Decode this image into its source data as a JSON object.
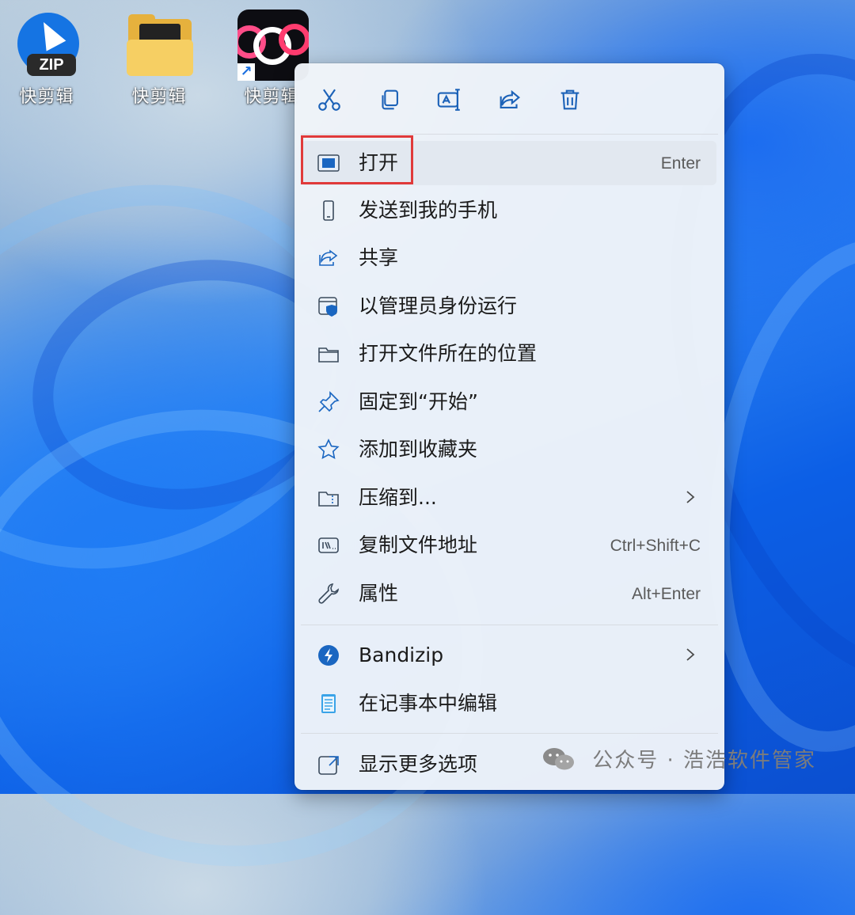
{
  "desktop": {
    "icons": [
      {
        "label": "快剪辑",
        "icon": "zip-archive-icon",
        "badge": "ZIP"
      },
      {
        "label": "快剪辑",
        "icon": "folder-icon"
      },
      {
        "label": "快剪辑",
        "icon": "app-shortcut-icon"
      }
    ]
  },
  "toolbar": {
    "buttons": [
      "cut-icon",
      "copy-icon",
      "rename-icon",
      "share-icon",
      "delete-icon"
    ]
  },
  "menu": {
    "items": [
      {
        "label": "打开",
        "shortcut": "Enter",
        "icon": "open-app-icon"
      },
      {
        "label": "发送到我的手机",
        "icon": "phone-icon"
      },
      {
        "label": "共享",
        "icon": "share-icon"
      },
      {
        "label": "以管理员身份运行",
        "icon": "admin-shield-icon"
      },
      {
        "label": "打开文件所在的位置",
        "icon": "folder-icon"
      },
      {
        "label": "固定到“开始”",
        "icon": "pin-icon"
      },
      {
        "label": "添加到收藏夹",
        "icon": "star-icon"
      },
      {
        "label": "压缩到...",
        "icon": "zip-folder-icon",
        "has_submenu": true
      },
      {
        "label": "复制文件地址",
        "shortcut": "Ctrl+Shift+C",
        "icon": "copy-path-icon"
      },
      {
        "label": "属性",
        "shortcut": "Alt+Enter",
        "icon": "wrench-icon"
      },
      {
        "label": "Bandizip",
        "icon": "bandizip-icon",
        "has_submenu": true
      },
      {
        "label": "在记事本中编辑",
        "icon": "notepad-icon"
      },
      {
        "label": "显示更多选项",
        "icon": "more-options-icon"
      }
    ]
  },
  "watermark": {
    "text": "公众号 · 浩浩软件管家"
  },
  "colors": {
    "accent": "#1a66c1",
    "highlight_box": "#e03a3a",
    "menu_bg": "#f0f4f9"
  }
}
